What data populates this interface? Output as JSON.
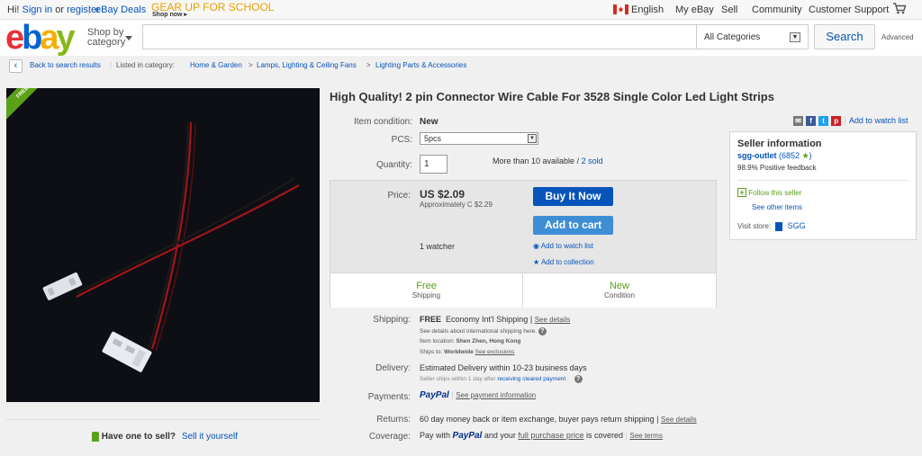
{
  "topbar": {
    "greeting": "Hi!",
    "sign_in": "Sign in",
    "or": "or",
    "register": "register",
    "deals": "eBay Deals",
    "promo_title": "GEAR UP FOR SCHOOL",
    "promo_sub": "Shop now ▸",
    "language": "English",
    "my_ebay": "My eBay",
    "sell": "Sell",
    "community": "Community",
    "support": "Customer Support"
  },
  "header": {
    "logo": [
      "e",
      "b",
      "a",
      "y"
    ],
    "shop_by": "Shop by",
    "category": "category",
    "search_placeholder": "",
    "category_select": "All Categories",
    "search_button": "Search",
    "advanced": "Advanced"
  },
  "breadcrumb": {
    "back": "Back to search results",
    "listed_in": "Listed in category:",
    "items": [
      "Home & Garden",
      "Lamps, Lighting & Ceiling Fans",
      "Lighting Parts & Accessories"
    ],
    "separator": ">"
  },
  "image": {
    "ribbon": "FREE SHIPPING"
  },
  "listing": {
    "title": "High Quality! 2 pin Connector Wire Cable For 3528 Single Color Led Light Strips",
    "condition_label": "Item condition:",
    "condition_value": "New",
    "pcs_label": "PCS:",
    "pcs_value": "5pcs",
    "quantity_label": "Quantity:",
    "quantity_value": "1",
    "available": "More than 10 available",
    "slash": "/",
    "sold": "2 sold",
    "price_label": "Price:",
    "price": "US $2.09",
    "approx": "Approximately C $2.29",
    "buy_now": "Buy It Now",
    "add_to_cart": "Add to cart",
    "watchers": "1 watcher",
    "add_watch": "Add to watch list",
    "add_collection": "Add to collection",
    "badge_free": "Free",
    "badge_shipping": "Shipping",
    "badge_new": "New",
    "badge_condition": "Condition"
  },
  "share": {
    "watch_link": "Add to watch list"
  },
  "seller": {
    "heading": "Seller information",
    "name": "sgg-outlet",
    "score_open": "(6852",
    "score_close": ")",
    "feedback": "98.9% Positive feedback",
    "follow": "Follow this seller",
    "other_items": "See other items",
    "visit_store": "Visit store:",
    "store_name": "SGG"
  },
  "details": {
    "shipping_label": "Shipping:",
    "shipping_free": "FREE",
    "shipping_method": "Economy Int'l Shipping",
    "shipping_pipe": "|",
    "see_details": "See details",
    "intl_note": "See details about international shipping here.",
    "item_location_label": "Item location:",
    "item_location": "Shen Zhen, Hong Kong",
    "ships_to_label": "Ships to:",
    "ships_to": "Worldwide",
    "see_exclusions": "See exclusions",
    "delivery_label": "Delivery:",
    "delivery_value": "Estimated Delivery within 10-23 business days",
    "delivery_note_a": "Seller ships within 1 day after",
    "delivery_note_link": "receiving cleared payment",
    "delivery_note_b": ".",
    "payments_label": "Payments:",
    "paypal": "PayPal",
    "see_payment": "See payment information",
    "returns_label": "Returns:",
    "returns_value": "60 day money back or item exchange, buyer pays return shipping",
    "coverage_label": "Coverage:",
    "coverage_a": "Pay with",
    "coverage_b": "and your",
    "coverage_link": "full purchase price",
    "coverage_c": "is covered",
    "see_terms": "See terms"
  },
  "sell_prompt": {
    "question": "Have one to sell?",
    "link": "Sell it yourself"
  },
  "colors": {
    "ebay_blue": "#0654ba",
    "free_green": "#5aa11a",
    "paypal_dark": "#003087",
    "paypal_light": "#009cde"
  }
}
